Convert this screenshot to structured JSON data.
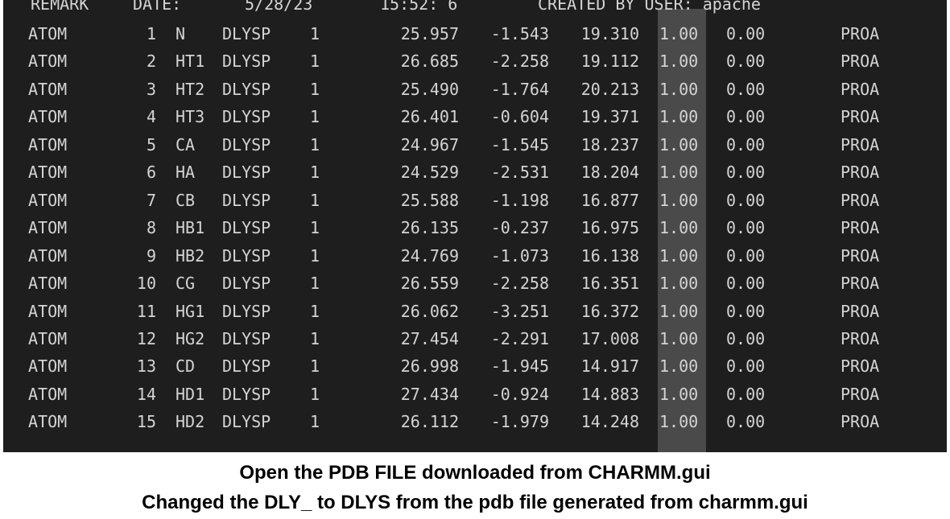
{
  "header": {
    "remark": "REMARK",
    "date_label": "DATE:",
    "date": "5/28/23",
    "time": "15:52: 6",
    "created_by": "CREATED BY USER: apache"
  },
  "atoms": [
    {
      "record": "ATOM",
      "serial": "1",
      "name": "N",
      "resname": "DLYSP",
      "resseq": "1",
      "x": "25.957",
      "y": "-1.543",
      "z": "19.310",
      "occupancy": "1.00",
      "bfactor": "0.00",
      "segid": "PROA"
    },
    {
      "record": "ATOM",
      "serial": "2",
      "name": "HT1",
      "resname": "DLYSP",
      "resseq": "1",
      "x": "26.685",
      "y": "-2.258",
      "z": "19.112",
      "occupancy": "1.00",
      "bfactor": "0.00",
      "segid": "PROA"
    },
    {
      "record": "ATOM",
      "serial": "3",
      "name": "HT2",
      "resname": "DLYSP",
      "resseq": "1",
      "x": "25.490",
      "y": "-1.764",
      "z": "20.213",
      "occupancy": "1.00",
      "bfactor": "0.00",
      "segid": "PROA"
    },
    {
      "record": "ATOM",
      "serial": "4",
      "name": "HT3",
      "resname": "DLYSP",
      "resseq": "1",
      "x": "26.401",
      "y": "-0.604",
      "z": "19.371",
      "occupancy": "1.00",
      "bfactor": "0.00",
      "segid": "PROA"
    },
    {
      "record": "ATOM",
      "serial": "5",
      "name": "CA",
      "resname": "DLYSP",
      "resseq": "1",
      "x": "24.967",
      "y": "-1.545",
      "z": "18.237",
      "occupancy": "1.00",
      "bfactor": "0.00",
      "segid": "PROA"
    },
    {
      "record": "ATOM",
      "serial": "6",
      "name": "HA",
      "resname": "DLYSP",
      "resseq": "1",
      "x": "24.529",
      "y": "-2.531",
      "z": "18.204",
      "occupancy": "1.00",
      "bfactor": "0.00",
      "segid": "PROA"
    },
    {
      "record": "ATOM",
      "serial": "7",
      "name": "CB",
      "resname": "DLYSP",
      "resseq": "1",
      "x": "25.588",
      "y": "-1.198",
      "z": "16.877",
      "occupancy": "1.00",
      "bfactor": "0.00",
      "segid": "PROA"
    },
    {
      "record": "ATOM",
      "serial": "8",
      "name": "HB1",
      "resname": "DLYSP",
      "resseq": "1",
      "x": "26.135",
      "y": "-0.237",
      "z": "16.975",
      "occupancy": "1.00",
      "bfactor": "0.00",
      "segid": "PROA"
    },
    {
      "record": "ATOM",
      "serial": "9",
      "name": "HB2",
      "resname": "DLYSP",
      "resseq": "1",
      "x": "24.769",
      "y": "-1.073",
      "z": "16.138",
      "occupancy": "1.00",
      "bfactor": "0.00",
      "segid": "PROA"
    },
    {
      "record": "ATOM",
      "serial": "10",
      "name": "CG",
      "resname": "DLYSP",
      "resseq": "1",
      "x": "26.559",
      "y": "-2.258",
      "z": "16.351",
      "occupancy": "1.00",
      "bfactor": "0.00",
      "segid": "PROA"
    },
    {
      "record": "ATOM",
      "serial": "11",
      "name": "HG1",
      "resname": "DLYSP",
      "resseq": "1",
      "x": "26.062",
      "y": "-3.251",
      "z": "16.372",
      "occupancy": "1.00",
      "bfactor": "0.00",
      "segid": "PROA"
    },
    {
      "record": "ATOM",
      "serial": "12",
      "name": "HG2",
      "resname": "DLYSP",
      "resseq": "1",
      "x": "27.454",
      "y": "-2.291",
      "z": "17.008",
      "occupancy": "1.00",
      "bfactor": "0.00",
      "segid": "PROA"
    },
    {
      "record": "ATOM",
      "serial": "13",
      "name": "CD",
      "resname": "DLYSP",
      "resseq": "1",
      "x": "26.998",
      "y": "-1.945",
      "z": "14.917",
      "occupancy": "1.00",
      "bfactor": "0.00",
      "segid": "PROA"
    },
    {
      "record": "ATOM",
      "serial": "14",
      "name": "HD1",
      "resname": "DLYSP",
      "resseq": "1",
      "x": "27.434",
      "y": "-0.924",
      "z": "14.883",
      "occupancy": "1.00",
      "bfactor": "0.00",
      "segid": "PROA"
    },
    {
      "record": "ATOM",
      "serial": "15",
      "name": "HD2",
      "resname": "DLYSP",
      "resseq": "1",
      "x": "26.112",
      "y": "-1.979",
      "z": "14.248",
      "occupancy": "1.00",
      "bfactor": "0.00",
      "segid": "PROA"
    }
  ],
  "captions": [
    "Open the PDB FILE downloaded from CHARMM.gui",
    "Changed the DLY_ to DLYS from the pdb file generated from charmm.gui"
  ],
  "colors": {
    "terminal_background": "#1e1e1e",
    "terminal_text": "#d4d4d4",
    "column_selection": "#4a4a4a"
  }
}
